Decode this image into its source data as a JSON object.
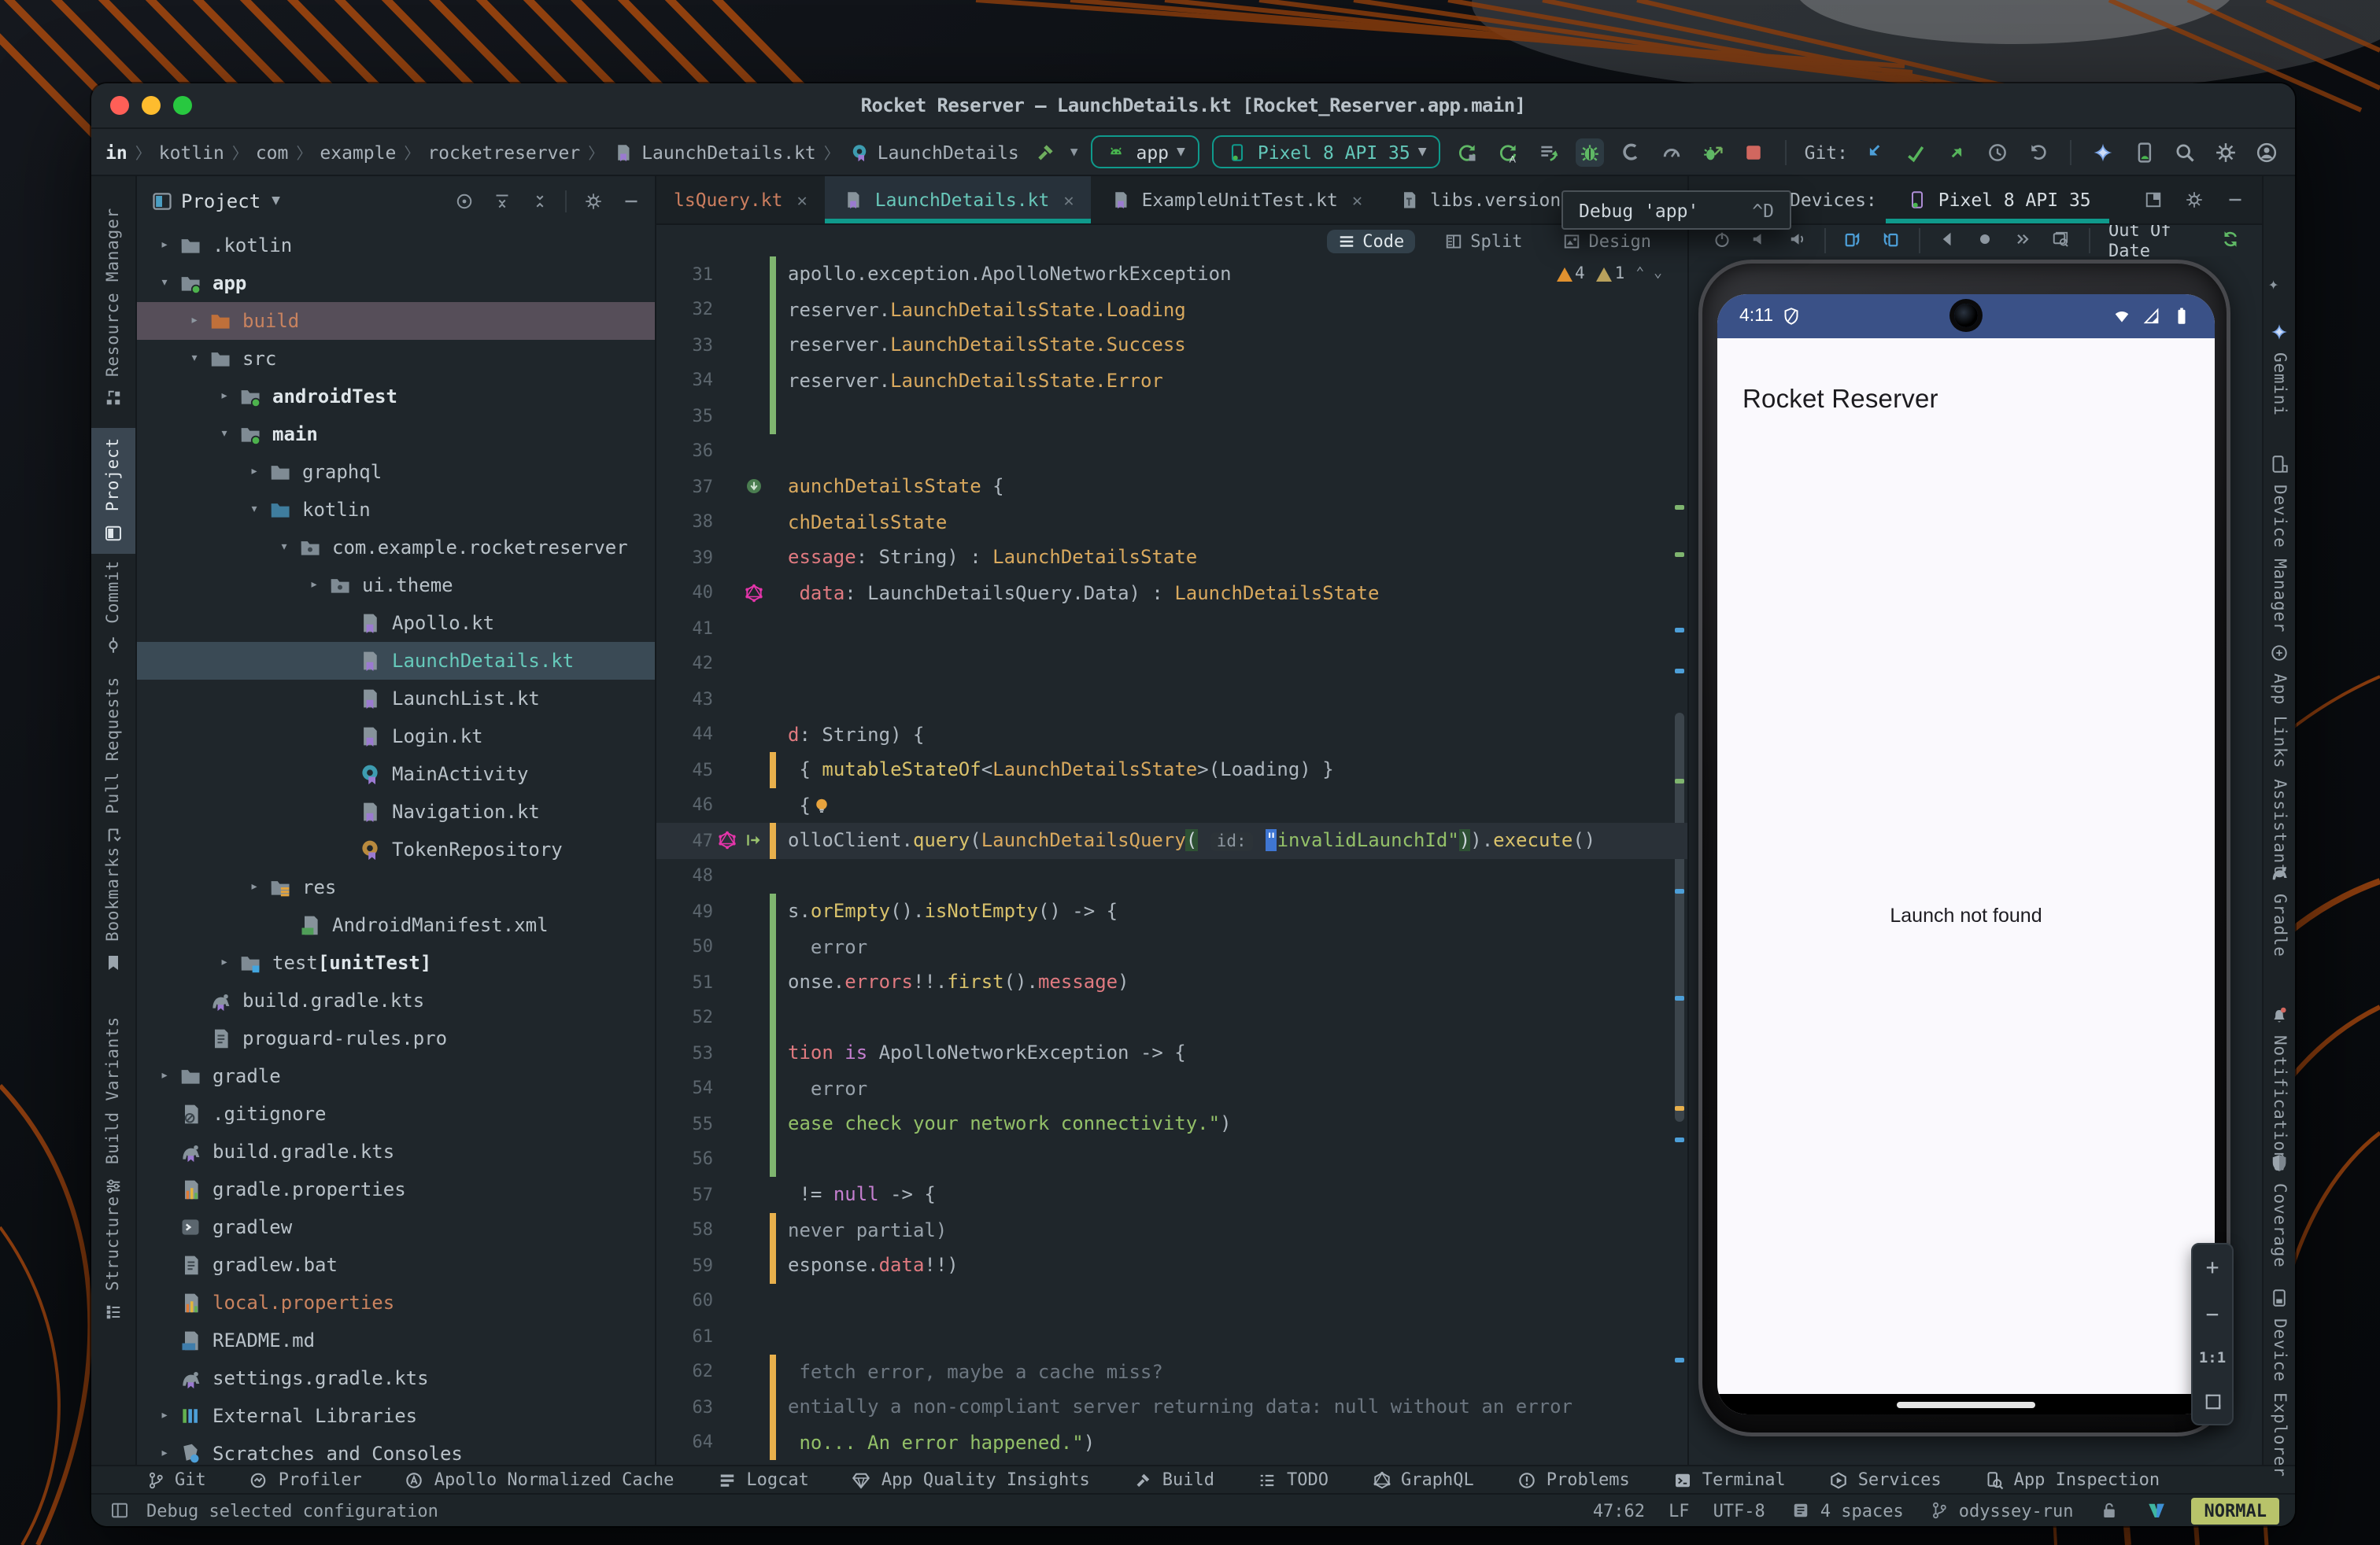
{
  "window": {
    "title": "Rocket Reserver – LaunchDetails.kt [Rocket_Reserver.app.main]"
  },
  "breadcrumbs": [
    "in",
    "kotlin",
    "com",
    "example",
    "rocketreserver",
    "LaunchDetails.kt",
    "LaunchDetails"
  ],
  "run_controls": {
    "config_label": "app",
    "device_label": "Pixel 8 API 35",
    "git_label": "Git:",
    "action_icons": [
      "rerun",
      "apply-changes",
      "apply-code-changes",
      "debug",
      "coverage",
      "profiler",
      "attach-debugger",
      "stop"
    ],
    "git_icons": [
      "update",
      "commit",
      "push",
      "history",
      "rollback"
    ],
    "trailing_icons": [
      "gemini",
      "mirror-device",
      "search",
      "settings",
      "account"
    ]
  },
  "project_panel": {
    "header": "Project",
    "tree": [
      {
        "label": ".kotlin",
        "depth": 1,
        "icon": "folder",
        "chev": "c"
      },
      {
        "label": "app",
        "depth": 1,
        "icon": "folder-run",
        "chev": "o",
        "bold": true
      },
      {
        "label": "build",
        "depth": 2,
        "icon": "folder-build",
        "chev": "c",
        "row": "drop",
        "cls": "salmon"
      },
      {
        "label": "src",
        "depth": 2,
        "icon": "folder",
        "chev": "o"
      },
      {
        "label": "androidTest",
        "depth": 3,
        "icon": "folder-run",
        "chev": "c",
        "bold": true
      },
      {
        "label": "main",
        "depth": 3,
        "icon": "folder-run",
        "chev": "o",
        "bold": true
      },
      {
        "label": "graphql",
        "depth": 4,
        "icon": "folder",
        "chev": "c"
      },
      {
        "label": "kotlin",
        "depth": 4,
        "icon": "folder-src",
        "chev": "o"
      },
      {
        "label": "com.example.rocketreserver",
        "depth": 5,
        "icon": "package",
        "chev": "o"
      },
      {
        "label": "ui.theme",
        "depth": 6,
        "icon": "package",
        "chev": "c"
      },
      {
        "label": "Apollo.kt",
        "depth": 7,
        "icon": "kt"
      },
      {
        "label": "LaunchDetails.kt",
        "depth": 7,
        "icon": "kt",
        "row": "sel"
      },
      {
        "label": "LaunchList.kt",
        "depth": 7,
        "icon": "kt"
      },
      {
        "label": "Login.kt",
        "depth": 7,
        "icon": "kt"
      },
      {
        "label": "MainActivity",
        "depth": 7,
        "icon": "class-c"
      },
      {
        "label": "Navigation.kt",
        "depth": 7,
        "icon": "kt"
      },
      {
        "label": "TokenRepository",
        "depth": 7,
        "icon": "class-o"
      },
      {
        "label": "res",
        "depth": 4,
        "icon": "folder-res",
        "chev": "c"
      },
      {
        "label": "AndroidManifest.xml",
        "depth": 5,
        "icon": "manifest"
      },
      {
        "label": "test",
        "suffix": " [unitTest]",
        "depth": 3,
        "icon": "folder-test",
        "chev": "c"
      },
      {
        "label": "build.gradle.kts",
        "depth": 2,
        "icon": "gradle"
      },
      {
        "label": "proguard-rules.pro",
        "depth": 2,
        "icon": "file"
      },
      {
        "label": "gradle",
        "depth": 1,
        "icon": "folder",
        "chev": "c"
      },
      {
        "label": ".gitignore",
        "depth": 1,
        "icon": "git"
      },
      {
        "label": "build.gradle.kts",
        "depth": 1,
        "icon": "gradle"
      },
      {
        "label": "gradle.properties",
        "depth": 1,
        "icon": "prop"
      },
      {
        "label": "gradlew",
        "depth": 1,
        "icon": "script"
      },
      {
        "label": "gradlew.bat",
        "depth": 1,
        "icon": "file"
      },
      {
        "label": "local.properties",
        "depth": 1,
        "icon": "prop",
        "cls": "salmon"
      },
      {
        "label": "README.md",
        "depth": 1,
        "icon": "md"
      },
      {
        "label": "settings.gradle.kts",
        "depth": 1,
        "icon": "gradle"
      },
      {
        "label": "External Libraries",
        "depth": 1,
        "icon": "lib",
        "chev": "c"
      },
      {
        "label": "Scratches and Consoles",
        "depth": 1,
        "icon": "scratch",
        "chev": "c"
      }
    ]
  },
  "editor": {
    "tabs": [
      {
        "label": "lsQuery.kt",
        "cls": "salmon"
      },
      {
        "label": "LaunchDetails.kt",
        "icon": "kt",
        "active": true
      },
      {
        "label": "ExampleUnitTest.kt",
        "icon": "kt"
      },
      {
        "label": "libs.versions.toml",
        "icon": "toml"
      }
    ],
    "view_modes": [
      "Code",
      "Split",
      "Design"
    ],
    "active_mode": "Code",
    "inspections": {
      "warnings": "4",
      "weak_warnings": "1"
    },
    "lines": [
      {
        "n": 31,
        "bar": "g",
        "segs": [
          {
            "t": "apollo.exception.ApolloNetworkException",
            "c": "p"
          }
        ]
      },
      {
        "n": 32,
        "bar": "g",
        "segs": [
          {
            "t": "reserver.",
            "c": "p"
          },
          {
            "t": "LaunchDetailsState.Loading",
            "c": "t"
          }
        ]
      },
      {
        "n": 33,
        "bar": "g",
        "segs": [
          {
            "t": "reserver.",
            "c": "p"
          },
          {
            "t": "LaunchDetailsState.Success",
            "c": "t"
          }
        ]
      },
      {
        "n": 34,
        "bar": "g",
        "segs": [
          {
            "t": "reserver.",
            "c": "p"
          },
          {
            "t": "LaunchDetailsState.Error",
            "c": "t"
          }
        ]
      },
      {
        "n": 35,
        "bar": "g",
        "segs": []
      },
      {
        "n": 36,
        "segs": []
      },
      {
        "n": 37,
        "icon": "impl",
        "segs": [
          {
            "t": "aunchDetailsState",
            "c": "t"
          },
          {
            "t": " {",
            "c": "p"
          }
        ]
      },
      {
        "n": 38,
        "segs": [
          {
            "t": "chDetailsState",
            "c": "t"
          }
        ]
      },
      {
        "n": 39,
        "segs": [
          {
            "t": "essage",
            "c": "r"
          },
          {
            "t": ": String) : ",
            "c": "p"
          },
          {
            "t": "LaunchDetailsState",
            "c": "t"
          }
        ]
      },
      {
        "n": 40,
        "icon": "graphql",
        "segs": [
          {
            "t": " ",
            "c": "p"
          },
          {
            "t": "data",
            "c": "r"
          },
          {
            "t": ": LaunchDetailsQuery.Data) : ",
            "c": "p"
          },
          {
            "t": "LaunchDetailsState",
            "c": "t"
          }
        ]
      },
      {
        "n": 41,
        "segs": []
      },
      {
        "n": 42,
        "segs": []
      },
      {
        "n": 43,
        "segs": []
      },
      {
        "n": 44,
        "segs": [
          {
            "t": "d",
            "c": "r"
          },
          {
            "t": ": String) {",
            "c": "p"
          }
        ]
      },
      {
        "n": 45,
        "bar": "o",
        "segs": [
          {
            "t": " { ",
            "c": "p"
          },
          {
            "t": "mutableStateOf",
            "c": "f"
          },
          {
            "t": "<",
            "c": "p"
          },
          {
            "t": "LaunchDetailsState",
            "c": "t"
          },
          {
            "t": ">(Loading) }",
            "c": "p"
          }
        ]
      },
      {
        "n": 46,
        "bulb": true,
        "segs": [
          {
            "t": " {",
            "c": "p"
          }
        ]
      },
      {
        "n": 47,
        "bar": "o",
        "active": true,
        "icon": "graphql",
        "icon2": "exec",
        "segs": [
          {
            "t": "olloClient.",
            "c": "p"
          },
          {
            "t": "query",
            "c": "f"
          },
          {
            "t": "(",
            "c": "p"
          },
          {
            "t": "LaunchDetailsQuery",
            "c": "t"
          },
          {
            "t": "(",
            "c": "phl"
          },
          {
            "t": " ",
            "c": "p"
          },
          {
            "t": "id:",
            "c": "hint"
          },
          {
            "t": " ",
            "c": "p"
          },
          {
            "t": "\"",
            "c": "cur"
          },
          {
            "t": "invalidLaunchId\"",
            "c": "s"
          },
          {
            "t": ")",
            "c": "phl"
          },
          {
            "t": ").",
            "c": "p"
          },
          {
            "t": "execute",
            "c": "f"
          },
          {
            "t": "()",
            "c": "p"
          }
        ]
      },
      {
        "n": 48,
        "segs": []
      },
      {
        "n": 49,
        "bar": "g",
        "segs": [
          {
            "t": "s.",
            "c": "p"
          },
          {
            "t": "orEmpty",
            "c": "f"
          },
          {
            "t": "().",
            "c": "p"
          },
          {
            "t": "isNotEmpty",
            "c": "f"
          },
          {
            "t": "() -> {",
            "c": "p"
          }
        ]
      },
      {
        "n": 50,
        "bar": "g",
        "segs": [
          {
            "t": "  error",
            "c": "g"
          }
        ]
      },
      {
        "n": 51,
        "bar": "g",
        "segs": [
          {
            "t": "onse.",
            "c": "p"
          },
          {
            "t": "errors",
            "c": "r"
          },
          {
            "t": "!!.",
            "c": "p"
          },
          {
            "t": "first",
            "c": "f"
          },
          {
            "t": "().",
            "c": "p"
          },
          {
            "t": "message",
            "c": "r"
          },
          {
            "t": ")",
            "c": "p"
          }
        ]
      },
      {
        "n": 52,
        "bar": "g",
        "segs": []
      },
      {
        "n": 53,
        "bar": "g",
        "segs": [
          {
            "t": "tion ",
            "c": "r"
          },
          {
            "t": "is",
            "c": "k"
          },
          {
            "t": " ApolloNetworkException -> {",
            "c": "p"
          }
        ]
      },
      {
        "n": 54,
        "bar": "g",
        "segs": [
          {
            "t": "  error",
            "c": "g"
          }
        ]
      },
      {
        "n": 55,
        "bar": "g",
        "segs": [
          {
            "t": "ease check your network connectivity.\"",
            "c": "s"
          },
          {
            "t": ")",
            "c": "p"
          }
        ]
      },
      {
        "n": 56,
        "bar": "g",
        "segs": []
      },
      {
        "n": 57,
        "segs": [
          {
            "t": " != ",
            "c": "p"
          },
          {
            "t": "null",
            "c": "k"
          },
          {
            "t": " -> {",
            "c": "p"
          }
        ]
      },
      {
        "n": 58,
        "bar": "o",
        "segs": [
          {
            "t": "never partial)",
            "c": "g"
          }
        ]
      },
      {
        "n": 59,
        "bar": "o",
        "segs": [
          {
            "t": "esponse.",
            "c": "p"
          },
          {
            "t": "data",
            "c": "r"
          },
          {
            "t": "!!)",
            "c": "p"
          }
        ]
      },
      {
        "n": 60,
        "segs": []
      },
      {
        "n": 61,
        "segs": []
      },
      {
        "n": 62,
        "bar": "o",
        "segs": [
          {
            "t": " fetch error, maybe a cache miss?",
            "c": "c"
          }
        ]
      },
      {
        "n": 63,
        "bar": "o",
        "segs": [
          {
            "t": "entially a non-compliant server returning data: null without an error",
            "c": "c"
          }
        ]
      },
      {
        "n": 64,
        "bar": "o",
        "segs": [
          {
            "t": " no... An error happened.\"",
            "c": "s"
          },
          {
            "t": ")",
            "c": "p"
          }
        ]
      }
    ]
  },
  "tooltip": {
    "label": "Debug 'app'",
    "shortcut": "^D"
  },
  "devices_panel": {
    "label": "Devices:",
    "tab_label": "Pixel 8 API 35",
    "status_label": "Out Of Date",
    "toolbar_icons": [
      "power",
      "volume-down",
      "volume-up",
      "rotate-left",
      "rotate-right",
      "nav-back",
      "nav-home",
      "nav-recents",
      "screenshot"
    ],
    "zoom_plus": "+",
    "zoom_minus": "−",
    "zoom_11": "1:1",
    "phone": {
      "time": "4:11",
      "app_title": "Rocket Reserver",
      "message": "Launch not found"
    }
  },
  "left_toolbar": [
    {
      "label": "Resource Manager",
      "icon": "resource-manager"
    },
    {
      "label": "Project",
      "icon": "project",
      "active": true
    },
    {
      "label": "Commit",
      "icon": "commit"
    },
    {
      "label": "Pull Requests",
      "icon": "pull-requests"
    },
    {
      "label": "Bookmarks",
      "icon": "bookmarks"
    },
    {
      "label": "Build Variants",
      "icon": "build-variants"
    },
    {
      "label": "Structure",
      "icon": "structure"
    }
  ],
  "right_toolbar": [
    {
      "label": "Gemini",
      "icon": "gemini"
    },
    {
      "label": "Device Manager",
      "icon": "device-manager"
    },
    {
      "label": "App Links Assistant",
      "icon": "app-links"
    },
    {
      "label": "Gradle",
      "icon": "gradle-el"
    },
    {
      "label": "Notifications",
      "icon": "notifications"
    },
    {
      "label": "Coverage",
      "icon": "coverage-shield"
    },
    {
      "label": "Device Explorer",
      "icon": "device-explorer"
    }
  ],
  "bottom_toolbar": [
    {
      "label": "Git",
      "icon": "branch"
    },
    {
      "label": "Profiler",
      "icon": "profiler-b"
    },
    {
      "label": "Apollo Normalized Cache",
      "icon": "apollo"
    },
    {
      "label": "Logcat",
      "icon": "logcat"
    },
    {
      "label": "App Quality Insights",
      "icon": "aqi"
    },
    {
      "label": "Build",
      "icon": "hammer-b"
    },
    {
      "label": "TODO",
      "icon": "todo"
    },
    {
      "label": "GraphQL",
      "icon": "graphql-g"
    },
    {
      "label": "Problems",
      "icon": "problems"
    },
    {
      "label": "Terminal",
      "icon": "terminal"
    },
    {
      "label": "Services",
      "icon": "services"
    },
    {
      "label": "App Inspection",
      "icon": "inspection"
    }
  ],
  "status_bar": {
    "message": "Debug selected configuration",
    "position": "47:62",
    "line_sep": "LF",
    "encoding": "UTF-8",
    "indent": "4 spaces",
    "branch": "odyssey-run",
    "mode": "NORMAL"
  },
  "colors": {
    "accent_teal": "#0f9a8c",
    "selection_row": "#3a4a55",
    "drop_row": "#564e59",
    "statusbar_phone": "#3a5187",
    "vim_badge": "#b8c36a",
    "warning": "#e0912f",
    "change_added": "#7fb56f",
    "change_modified": "#e8b04c"
  }
}
